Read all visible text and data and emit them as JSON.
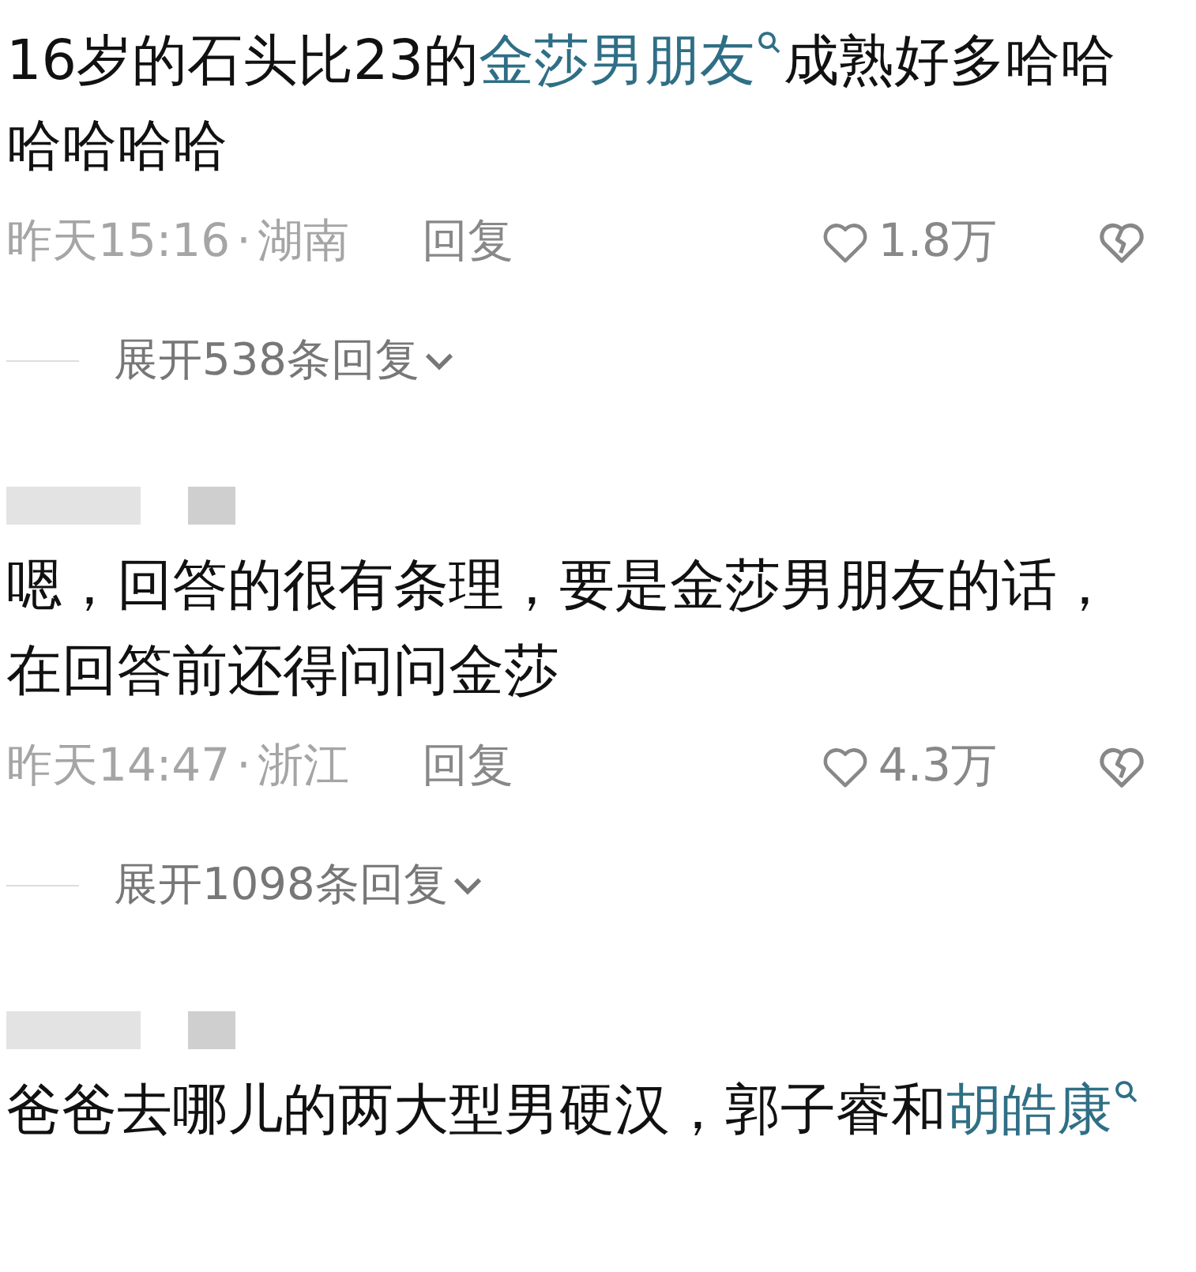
{
  "comments": [
    {
      "name_hidden": false,
      "segments": [
        {
          "text": "16岁的石头比23的",
          "link": false
        },
        {
          "text": "金莎男朋友",
          "link": true
        },
        {
          "text": "成熟好多哈哈哈哈哈哈",
          "link": false
        }
      ],
      "time": "昨天15:16",
      "separator": "·",
      "location": "湖南",
      "reply": "回复",
      "likes": "1.8万",
      "expand": "展开538条回复"
    },
    {
      "name_hidden": true,
      "segments": [
        {
          "text": "嗯，回答的很有条理，要是金莎男朋友的话，在回答前还得问问金莎",
          "link": false
        }
      ],
      "time": "昨天14:47",
      "separator": "·",
      "location": "浙江",
      "reply": "回复",
      "likes": "4.3万",
      "expand": "展开1098条回复"
    },
    {
      "name_hidden": true,
      "segments": [
        {
          "text": "爸爸去哪儿的两大型男硬汉，郭子睿和",
          "link": false
        },
        {
          "text": "胡皓康",
          "link": true
        }
      ]
    }
  ]
}
